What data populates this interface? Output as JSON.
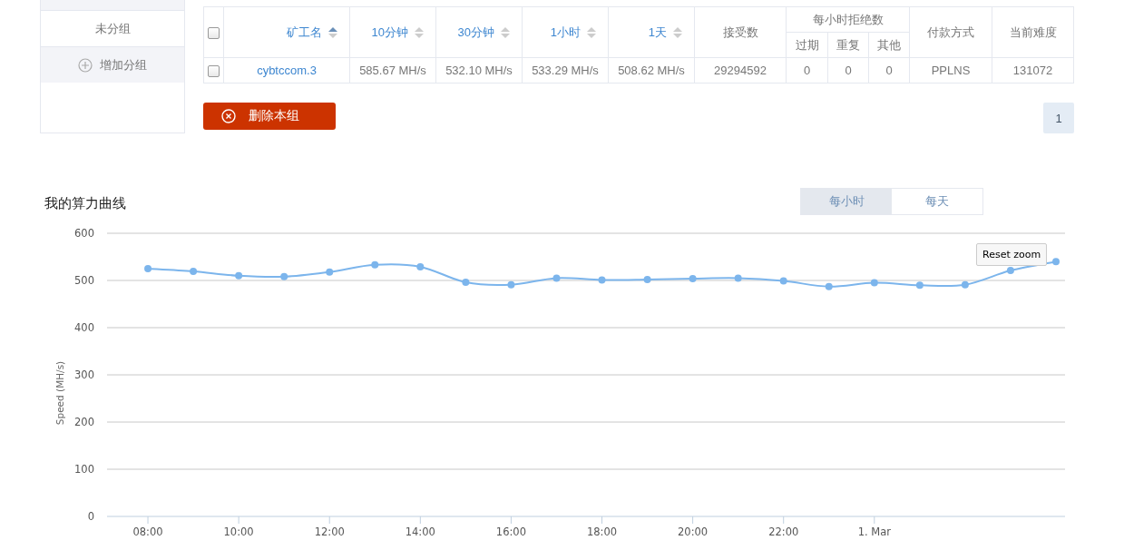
{
  "sidebar": {
    "items": [
      {
        "kind": "cut",
        "selected": false
      },
      {
        "label": "未分组",
        "kind": "group",
        "selected": true
      },
      {
        "label": "增加分组",
        "kind": "add",
        "selected": false
      }
    ]
  },
  "table": {
    "header_checked": false,
    "columns": [
      {
        "label": "矿工名",
        "kind": "sort",
        "sorted": true
      },
      {
        "label": "10分钟",
        "kind": "sort",
        "sorted": false
      },
      {
        "label": "30分钟",
        "kind": "sort",
        "sorted": false
      },
      {
        "label": "1小时",
        "kind": "sort",
        "sorted": false
      },
      {
        "label": "1天",
        "kind": "sort",
        "sorted": false
      },
      {
        "label": "接受数",
        "kind": "plain"
      },
      {
        "label": "每小时拒绝数",
        "kind": "group",
        "colspan": 3,
        "children": [
          "过期",
          "重复",
          "其他"
        ]
      },
      {
        "label": "付款方式",
        "kind": "plain"
      },
      {
        "label": "当前难度",
        "kind": "plain"
      }
    ],
    "rows": [
      {
        "checked": false,
        "cells": [
          "cybtccom.3",
          "585.67 MH/s",
          "532.10 MH/s",
          "533.29 MH/s",
          "508.62 MH/s",
          "29294592",
          "0",
          "0",
          "0",
          "PPLNS",
          "131072"
        ]
      }
    ]
  },
  "delete_button": "删除本组",
  "pagination": [
    {
      "label": "1",
      "selected": true
    }
  ],
  "chart_section": {
    "title": "我的算力曲线",
    "toggle": [
      {
        "label": "每小时",
        "selected": true
      },
      {
        "label": "每天",
        "selected": false
      }
    ],
    "reset_zoom": "Reset zoom",
    "chart_data": {
      "type": "line",
      "ylabel": "Speed (MH/s)",
      "x": [
        8,
        9,
        10,
        11,
        12,
        13,
        14,
        15,
        16,
        17,
        18,
        19,
        20,
        21,
        22,
        23,
        24,
        25,
        26,
        27,
        28
      ],
      "grid": true,
      "series": [
        {
          "color": "#7cb5ec",
          "marker": true,
          "values": [
            525,
            519,
            510,
            508,
            518,
            533,
            529,
            496,
            491,
            505,
            501,
            502,
            504,
            505,
            499,
            487,
            495,
            490,
            491,
            521,
            540
          ]
        }
      ],
      "xlim": [
        7.1,
        28.2
      ],
      "ylim": [
        0,
        600
      ],
      "xticks": [
        {
          "value": 8,
          "label": "08:00"
        },
        {
          "value": 10,
          "label": "10:00"
        },
        {
          "value": 12,
          "label": "12:00"
        },
        {
          "value": 14,
          "label": "14:00"
        },
        {
          "value": 16,
          "label": "16:00"
        },
        {
          "value": 18,
          "label": "18:00"
        },
        {
          "value": 20,
          "label": "20:00"
        },
        {
          "value": 22,
          "label": "22:00"
        },
        {
          "value": 24,
          "label": "1. Mar"
        }
      ],
      "yticks": [
        0,
        100,
        200,
        300,
        400,
        500,
        600
      ]
    }
  }
}
